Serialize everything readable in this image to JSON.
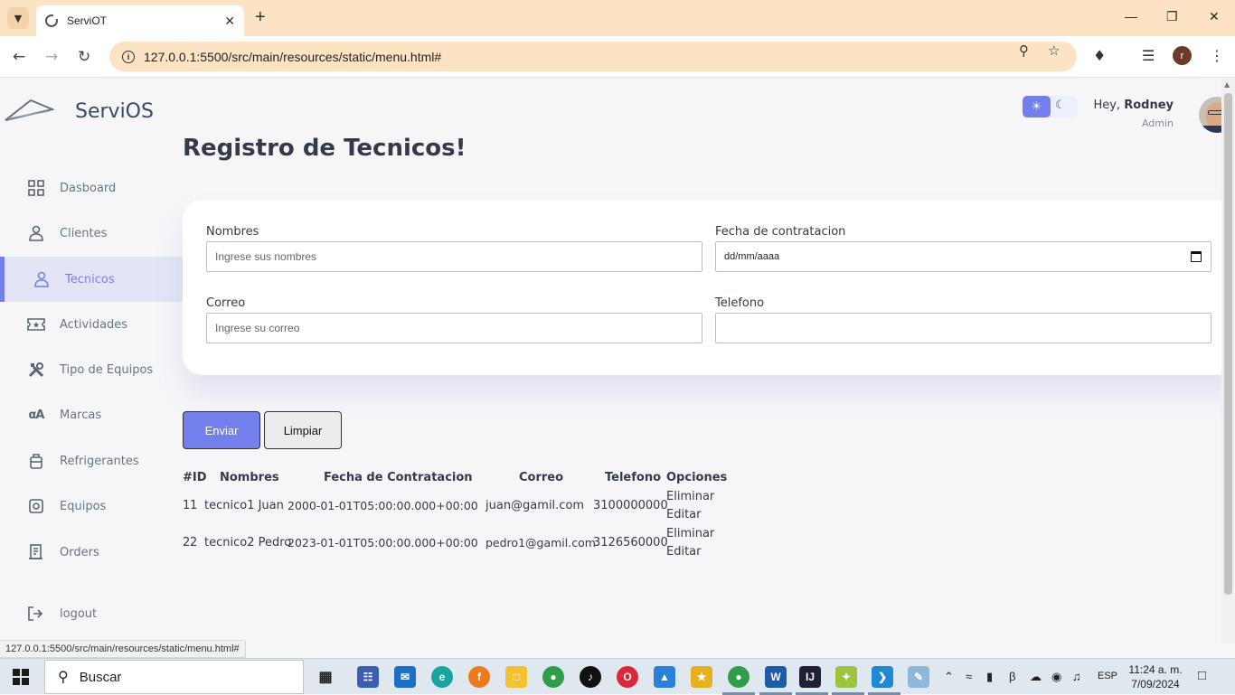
{
  "browser": {
    "tab_title": "ServiOT",
    "url": "127.0.0.1:5500/src/main/resources/static/menu.html#",
    "status_url": "127.0.0.1:5500/src/main/resources/static/menu.html#",
    "profile_initial": "r"
  },
  "app": {
    "brand": "ServiOS",
    "greeting_prefix": "Hey, ",
    "user_name": "Rodney",
    "user_role": "Admin",
    "accent_color": "#7380ec"
  },
  "sidebar": {
    "items": [
      {
        "label": "Dasboard",
        "icon": "grid-icon"
      },
      {
        "label": "Clientes",
        "icon": "person-icon"
      },
      {
        "label": "Tecnicos",
        "icon": "person-icon",
        "active": true
      },
      {
        "label": "Actividades",
        "icon": "ticket-icon"
      },
      {
        "label": "Tipo de Equipos",
        "icon": "tools-icon"
      },
      {
        "label": "Marcas",
        "icon": "translate-icon"
      },
      {
        "label": "Refrigerantes",
        "icon": "bag-icon"
      },
      {
        "label": "Equipos",
        "icon": "device-icon"
      },
      {
        "label": "Orders",
        "icon": "receipt-icon"
      }
    ],
    "logout": "logout"
  },
  "main": {
    "title": "Registro de Tecnicos!",
    "form": {
      "nombres_label": "Nombres",
      "nombres_placeholder": "Ingrese sus nombres",
      "fecha_label": "Fecha de contratacion",
      "fecha_placeholder": "dd/mm/aaaa",
      "correo_label": "Correo",
      "correo_placeholder": "Ingrese su correo",
      "telefono_label": "Telefono",
      "telefono_value": ""
    },
    "buttons": {
      "send": "Enviar",
      "clear": "Limpiar"
    },
    "table": {
      "headers": [
        "#ID",
        "Nombres",
        "Fecha de Contratacion",
        "Correo",
        "Telefono",
        "Opciones"
      ],
      "rows": [
        {
          "id": "1",
          "num": "1",
          "nombres": "tecnico1 Juan",
          "fecha": "2000-01-01T05:00:00.000+00:00",
          "correo": "juan@gamil.com",
          "telefono": "3100000000",
          "eliminar": "Eliminar",
          "editar": "Editar"
        },
        {
          "id": "2",
          "num": "2",
          "nombres": "tecnico2 Pedro",
          "fecha": "2023-01-01T05:00:00.000+00:00",
          "correo": "pedro1@gamil.com",
          "telefono": "3126560000",
          "eliminar": "Eliminar",
          "editar": "Editar"
        }
      ]
    }
  },
  "taskbar": {
    "search_label": "Buscar",
    "language": "ESP",
    "time": "11:24 a. m.",
    "date": "7/09/2024"
  }
}
